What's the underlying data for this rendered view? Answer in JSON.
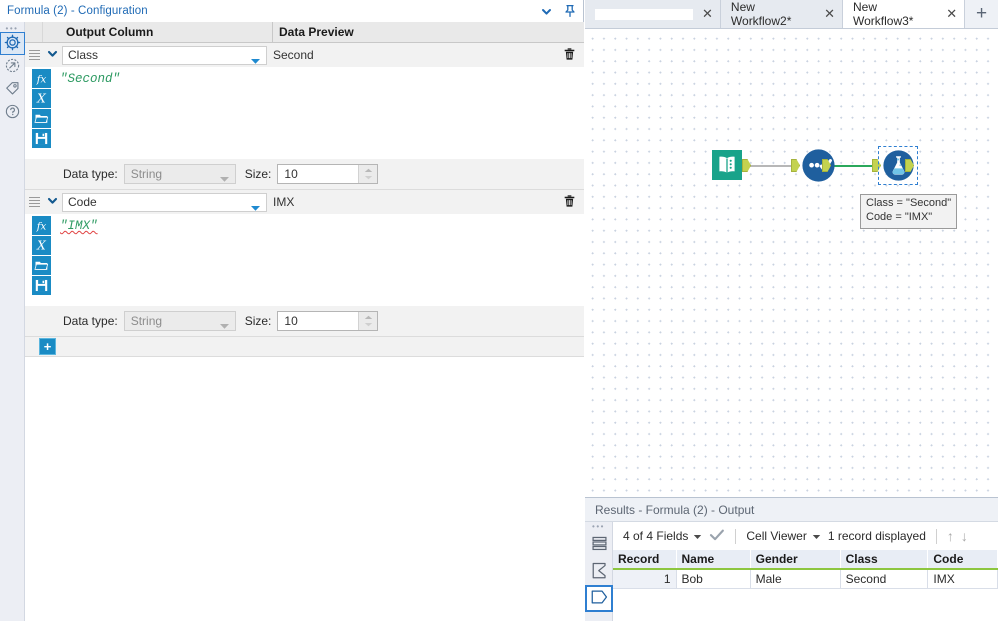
{
  "config": {
    "title": "Formula (2) - Configuration",
    "collapse_icon": "chevron-down-icon",
    "pin_icon": "pin-icon",
    "rail_icons": [
      "gear-icon",
      "arrow-circle-icon",
      "tag-icon",
      "help-icon"
    ],
    "columns": {
      "output": "Output Column",
      "preview": "Data Preview"
    },
    "formulas": [
      {
        "output_column": "Class",
        "data_preview": "Second",
        "expression": "\"Second\"",
        "expression_error": false,
        "data_type_label": "Data type:",
        "data_type": "String",
        "size_label": "Size:",
        "size": "10"
      },
      {
        "output_column": "Code",
        "data_preview": "IMX",
        "expression": "\"IMX\"",
        "expression_error": true,
        "data_type_label": "Data type:",
        "data_type": "String",
        "size_label": "Size:",
        "size": "10"
      }
    ],
    "add_label": "+",
    "editor_tools": [
      "fx-icon",
      "variable-x-icon",
      "folder-open-icon",
      "save-disk-icon"
    ],
    "delete_icon": "trash-icon"
  },
  "tabs": [
    {
      "label": "",
      "redacted": true,
      "active": false
    },
    {
      "label": "New Workflow2*",
      "redacted": false,
      "active": false
    },
    {
      "label": "New Workflow3*",
      "redacted": false,
      "active": true
    }
  ],
  "tab_add_label": "+",
  "canvas": {
    "tools": [
      {
        "name": "text-input-tool",
        "icon": "book-icon",
        "selected": false
      },
      {
        "name": "select-tool",
        "icon": "check-circle-icon",
        "selected": false
      },
      {
        "name": "formula-tool",
        "icon": "flask-icon",
        "selected": true
      }
    ],
    "annotation": "Class = \"Second\"\nCode = \"IMX\""
  },
  "results": {
    "title": "Results - Formula (2) - Output",
    "rail_icons": [
      "records-list-icon",
      "summary-sigma-icon",
      "output-anchor-icon"
    ],
    "fields_label": "4 of 4 Fields",
    "check_icon": "checkmark-icon",
    "viewer_label": "Cell Viewer",
    "records_label": "1 record displayed",
    "up_icon": "arrow-up-icon",
    "down_icon": "arrow-down-icon",
    "table": {
      "headers": [
        "Record",
        "Name",
        "Gender",
        "Class",
        "Code"
      ],
      "rows": [
        [
          "1",
          "Bob",
          "Male",
          "Second",
          "IMX"
        ]
      ]
    }
  },
  "colors": {
    "accent_blue": "#1f6ab5",
    "tool_blue": "#1a8bc4",
    "text_input_green": "#19a38a",
    "select_blue": "#1f5f9e",
    "anchor_green": "#c3d24f",
    "header_underline": "#8dc63f",
    "formula_text_green": "#2d9a62",
    "error_red": "#e04141"
  }
}
